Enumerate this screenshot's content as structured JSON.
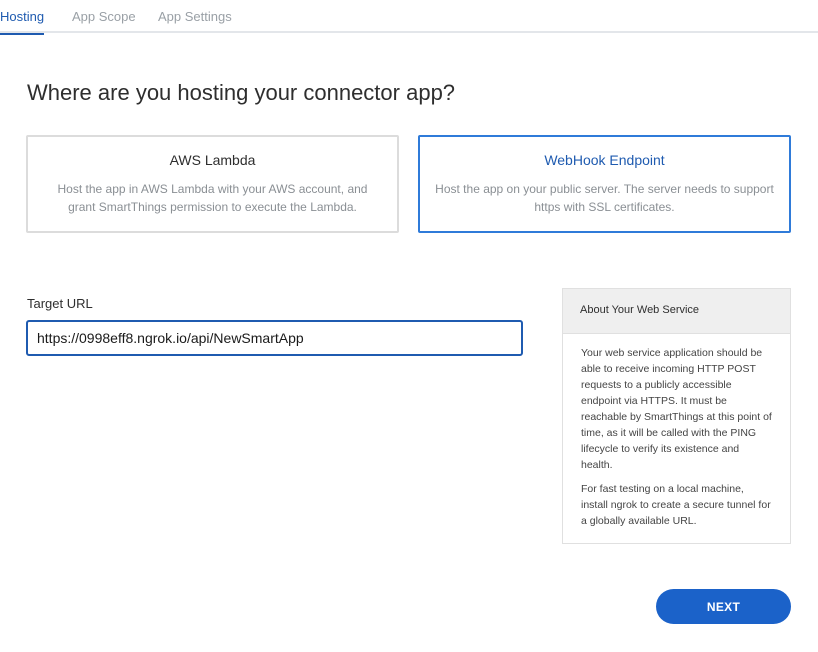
{
  "tabs": [
    {
      "label": "Hosting",
      "active": true
    },
    {
      "label": "App Scope",
      "active": false
    },
    {
      "label": "App Settings",
      "active": false
    }
  ],
  "heading": "Where are you hosting your connector app?",
  "options": [
    {
      "title": "AWS Lambda",
      "description": "Host the app in AWS Lambda with your AWS account, and grant SmartThings permission to execute the Lambda.",
      "selected": false
    },
    {
      "title": "WebHook Endpoint",
      "description": "Host the app on your public server. The server needs to support https with SSL certificates.",
      "selected": true
    }
  ],
  "target_url": {
    "label": "Target URL",
    "value": "https://0998eff8.ngrok.io/api/NewSmartApp"
  },
  "info_panel": {
    "title": "About Your Web Service",
    "paragraph1": "Your web service application should be able to receive incoming HTTP POST requests to a publicly accessible endpoint via HTTPS. It must be reachable by SmartThings at this point of time, as it will be called with the PING lifecycle to verify its existence and health.",
    "paragraph2": "For fast testing on a local machine, install ngrok to create a secure tunnel for a globally available URL."
  },
  "next_button": {
    "label": "NEXT"
  },
  "colors": {
    "accent": "#1f5bb0",
    "button": "#1b62c9",
    "selected_border": "#2f7bd9",
    "muted_text": "#8a8f94"
  }
}
